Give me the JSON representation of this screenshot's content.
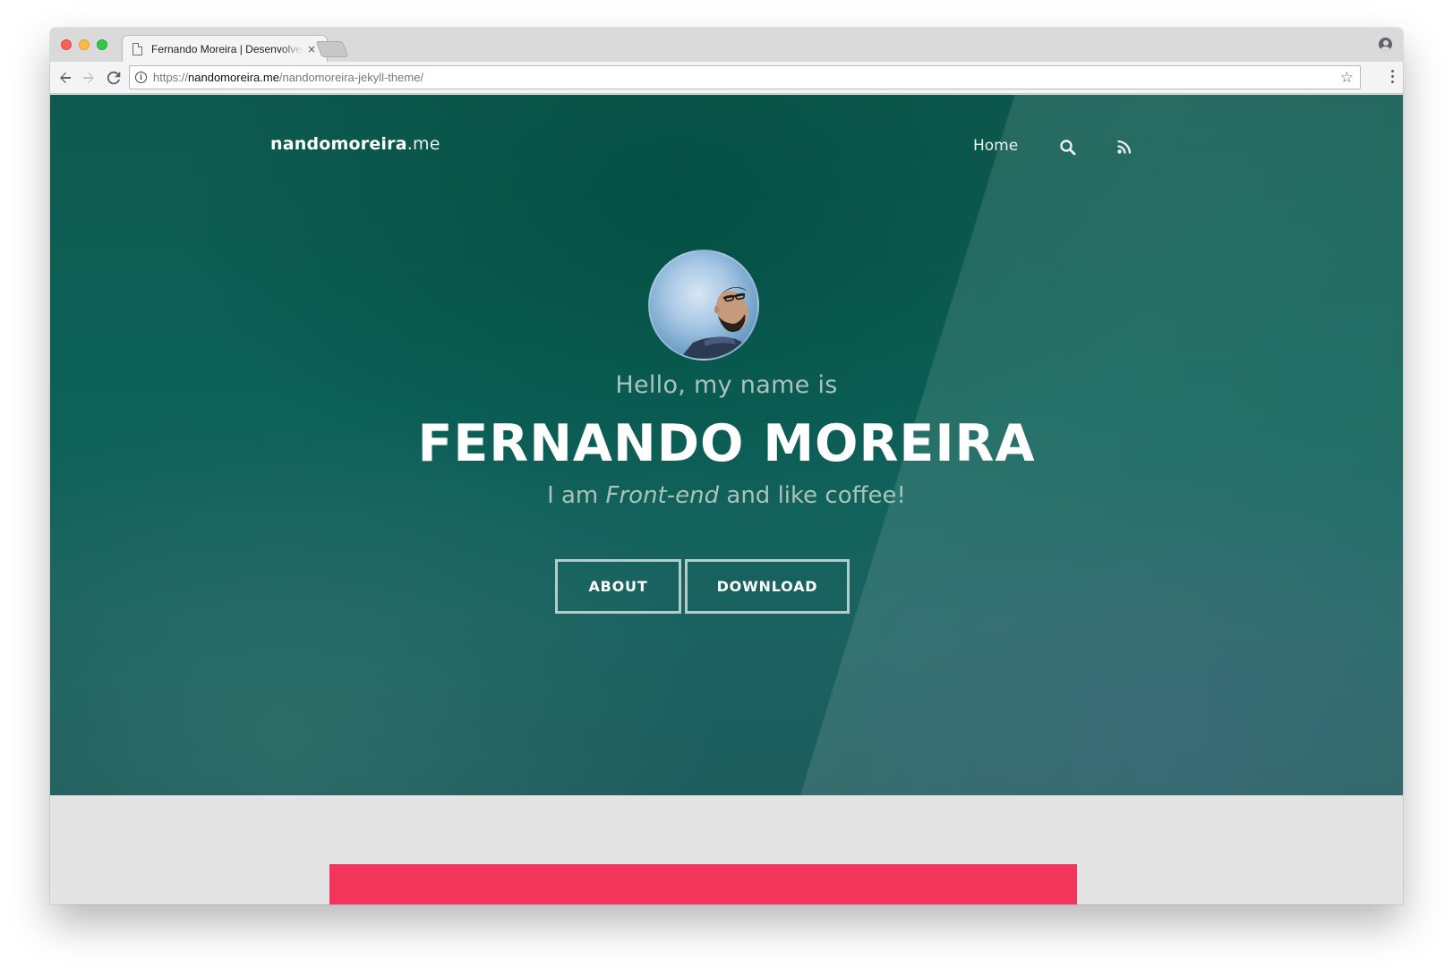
{
  "browser": {
    "tab_title": "Fernando Moreira | Desenvolvedor Front-end",
    "tab_close": "×",
    "url_scheme": "https://",
    "url_host": "nandomoreira.me",
    "url_path": "/nandomoreira-jekyll-theme/",
    "icons": [
      "back-arrow-icon",
      "forward-arrow-icon",
      "reload-icon",
      "info-icon",
      "star-icon",
      "menu-icon",
      "profile-icon",
      "page-icon"
    ]
  },
  "site": {
    "brand_bold": "nandomoreira",
    "brand_tld": ".me",
    "nav": {
      "home": "Home",
      "icons": [
        "search-icon",
        "rss-icon"
      ]
    },
    "hero": {
      "greeting": "Hello, my name is",
      "name": "FERNANDO MOREIRA",
      "tagline_before": "I am ",
      "tagline_em": "Front-end",
      "tagline_after": " and like coffee!",
      "buttons": {
        "about": "ABOUT",
        "download": "DOWNLOAD"
      }
    }
  },
  "colors": {
    "hero_base": "#0c6158",
    "accent_pink": "#f3355c",
    "page_bg": "#e4e4e4"
  }
}
